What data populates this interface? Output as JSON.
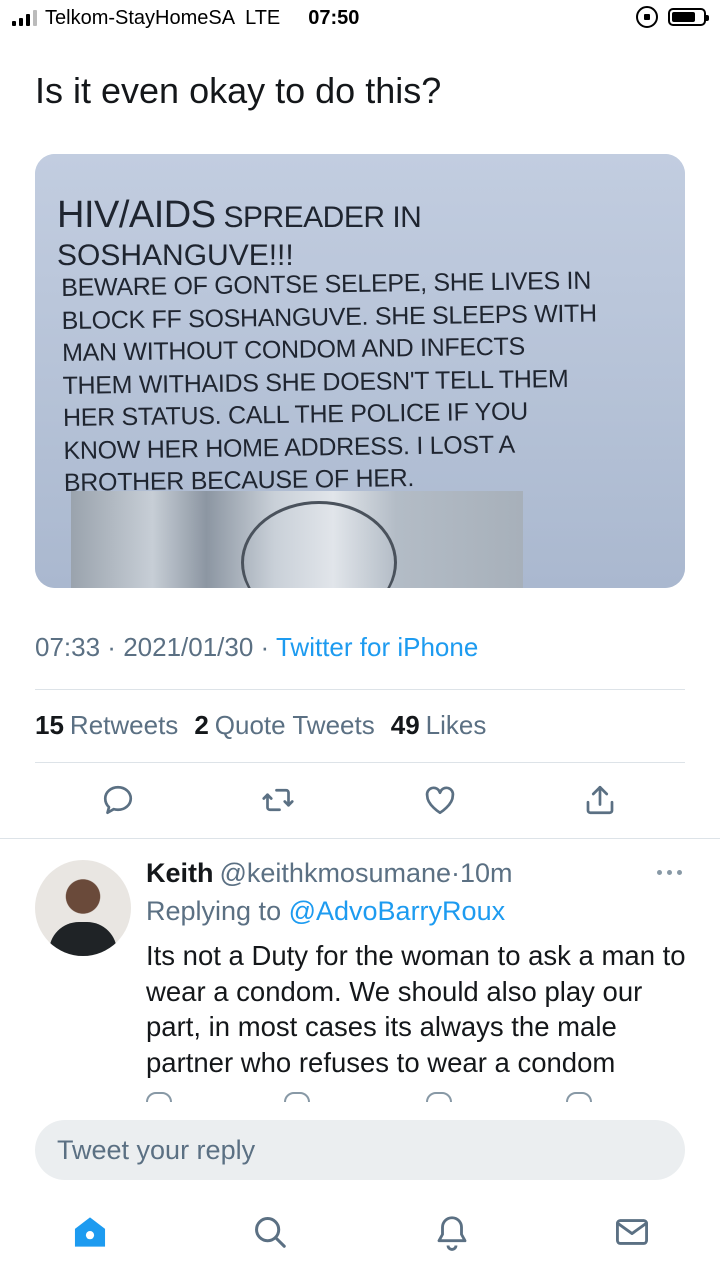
{
  "status_bar": {
    "carrier": "Telkom-StayHomeSA",
    "network": "LTE",
    "time": "07:50"
  },
  "tweet": {
    "text": "Is it even okay to do this?",
    "media": {
      "heading_big": "HIV/AIDS",
      "heading_small": " SPREADER IN",
      "heading_line2": "SOSHANGUVE!!!",
      "body": "BEWARE OF GONTSE SELEPE, SHE LIVES IN\nBLOCK FF SOSHANGUVE. SHE SLEEPS WITH\nMAN WITHOUT CONDOM  AND INFECTS\nTHEM WITHAIDS SHE DOESN'T TELL THEM\nHER STATUS. CALL THE POLICE  IF YOU\nKNOW HER HOME ADDRESS.  I LOST A\nBROTHER BECAUSE OF HER."
    },
    "time": "07:33",
    "date": "2021/01/30",
    "separator": " · ",
    "source": "Twitter for iPhone",
    "stats": {
      "retweets_count": "15",
      "retweets_label": "Retweets",
      "quotes_count": "2",
      "quotes_label": "Quote Tweets",
      "likes_count": "49",
      "likes_label": "Likes"
    },
    "actions": [
      "reply-icon",
      "retweet-icon",
      "like-icon",
      "share-icon"
    ]
  },
  "reply": {
    "name": "Keith",
    "handle": "@keithkmosumane",
    "dot": "·",
    "age": "10m",
    "replying_prefix": "Replying to ",
    "replying_handle": "@AdvoBarryRoux",
    "text": "Its not a Duty for the woman to ask a man to wear a condom. We should also play our part, in most cases its always the male partner who refuses to wear a condom"
  },
  "compose": {
    "placeholder": "Tweet your reply"
  },
  "tabbar": [
    "home-icon",
    "search-icon",
    "notifications-icon",
    "messages-icon"
  ],
  "colors": {
    "accent": "#1d9bf0",
    "secondary_text": "#5b7083",
    "primary_text": "#14171a"
  }
}
